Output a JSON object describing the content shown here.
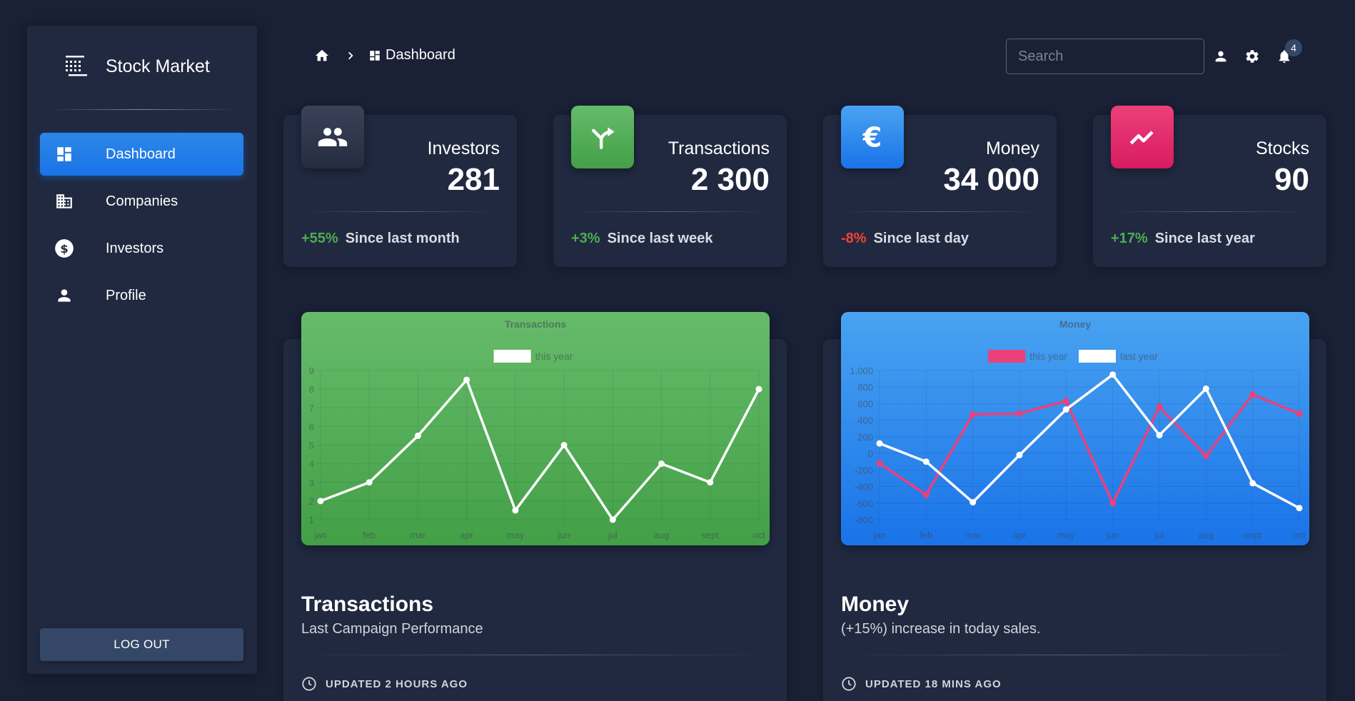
{
  "sidebar": {
    "brand": "Stock Market",
    "items": [
      {
        "label": "Dashboard",
        "icon": "dashboard-icon",
        "active": true
      },
      {
        "label": "Companies",
        "icon": "business-icon",
        "active": false
      },
      {
        "label": "Investors",
        "icon": "dollar-circle-icon",
        "active": false
      },
      {
        "label": "Profile",
        "icon": "person-icon",
        "active": false
      }
    ],
    "logout_label": "LOG OUT"
  },
  "header": {
    "breadcrumb_current": "Dashboard",
    "search_placeholder": "Search",
    "notification_count": "4"
  },
  "stats": [
    {
      "title": "Investors",
      "value": "281",
      "change": "+55%",
      "since": "Since last month",
      "icon": "people-icon",
      "color": "#2c3349",
      "change_color": "#4caf50"
    },
    {
      "title": "Transactions",
      "value": "2 300",
      "change": "+3%",
      "since": "Since last week",
      "icon": "merge-arrows-icon",
      "color": "#4caf50",
      "change_color": "#4caf50"
    },
    {
      "title": "Money",
      "value": "34 000",
      "change": "-8%",
      "since": "Since last day",
      "icon": "euro-icon",
      "color": "#1a73e8",
      "change_color": "#f44335"
    },
    {
      "title": "Stocks",
      "value": "90",
      "change": "+17%",
      "since": "Since last year",
      "icon": "trending-up-icon",
      "color": "#e91e63",
      "change_color": "#4caf50"
    }
  ],
  "cards": [
    {
      "title": "Transactions",
      "subtitle": "Last Campaign Performance",
      "updated": "UPDATED 2 HOURS AGO"
    },
    {
      "title": "Money",
      "subtitle": "(+15%) increase in today sales.",
      "updated": "UPDATED 18 MINS AGO"
    }
  ],
  "chart_data": [
    {
      "type": "line",
      "title": "Transactions",
      "categories": [
        "jan",
        "feb",
        "mar",
        "apr",
        "may",
        "jun",
        "jul",
        "aug",
        "sept",
        "oct"
      ],
      "ylim": [
        1,
        9
      ],
      "yticks": [
        "1",
        "2",
        "3",
        "4",
        "5",
        "6",
        "7",
        "8",
        "9"
      ],
      "series": [
        {
          "name": "this year",
          "values": [
            2,
            3,
            5.5,
            8.5,
            1.5,
            5,
            1,
            4,
            3,
            8
          ],
          "color": "#ffffff"
        }
      ]
    },
    {
      "type": "line",
      "title": "Money",
      "categories": [
        "jan",
        "feb",
        "mar",
        "apr",
        "may",
        "jun",
        "jul",
        "aug",
        "sept",
        "oct"
      ],
      "ylim": [
        -800,
        1000
      ],
      "yticks": [
        "-800",
        "-600",
        "-400",
        "-200",
        "0",
        "200",
        "400",
        "600",
        "800",
        "1,000"
      ],
      "series": [
        {
          "name": "this year",
          "values": [
            -120,
            -500,
            470,
            480,
            630,
            -600,
            560,
            -30,
            710,
            480
          ],
          "color": "#ec407a"
        },
        {
          "name": "last year",
          "values": [
            120,
            -100,
            -590,
            -20,
            530,
            950,
            220,
            780,
            -360,
            -660
          ],
          "color": "#ffffff"
        }
      ]
    }
  ]
}
